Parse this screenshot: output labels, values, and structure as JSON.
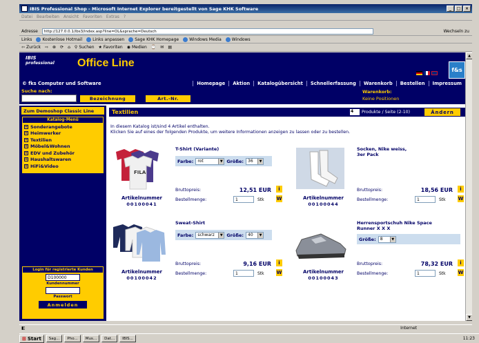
{
  "window": {
    "title": "IBIS Professional Shop - Microsoft Internet Explorer bereitgestellt von Sage KHK Software"
  },
  "menu": [
    "Datei",
    "Bearbeiten",
    "Ansicht",
    "Favoriten",
    "Extras",
    "?"
  ],
  "address": {
    "label": "Adresse",
    "url": "http://127.0.0.1/ibs3/index.asp?line=OL&sprache=Deutsch",
    "go": "Wechseln zu"
  },
  "links": {
    "label": "Links",
    "items": [
      "Kostenlose Hotmail",
      "Links anpassen",
      "Sage KHK Homepage",
      "Windows Media",
      "Windows"
    ]
  },
  "toolbar": {
    "back": "Zurück",
    "search": "Suchen",
    "favorites": "Favoriten",
    "media": "Medien"
  },
  "shop": {
    "logo_top": "IBIS",
    "logo_sub": "professional",
    "logo_main": "Office Line",
    "fs_logo": "f&s",
    "firm": "© fks Computer und Software",
    "nav": [
      "Homepage",
      "Aktion",
      "Katalogübersicht",
      "Schnellerfassung",
      "Warenkorb",
      "Bestellen",
      "Impressum"
    ],
    "search_label": "Suche nach:",
    "btn_bezeichnung": "Bezeichnung",
    "btn_artnr": "Art.-Nr.",
    "cart_label": "Warenkorb:",
    "cart_value": "Keine Positionen"
  },
  "sidebar": {
    "demoshop": "Zum Demoshop Classic Line",
    "catalog_head": "Katalog-Menü",
    "categories": [
      "Sonderangebote",
      "Heimwerker",
      "Textilien",
      "Möbel&Wohnen",
      "EDV und Zubehör",
      "Haushaltswaren",
      "HiFi&Video"
    ],
    "login_head": "Login für registrierte Kunden",
    "customer_no": "D100000",
    "customer_label": "Kundennummer",
    "password_label": "Passwort",
    "login_btn": "Anmelden"
  },
  "main": {
    "title": "Textilien",
    "per_page_value": "4",
    "per_page_label": "Produkte / Seite (2-10)",
    "change_btn": "Ändern",
    "intro1": "In diesem Katalog ist/sind 4 Artikel enthalten.",
    "intro2": "Klicken Sie auf eines der folgenden Produkte, um weitere Informationen anzeigen zu lassen oder zu bestellen."
  },
  "product_labels": {
    "artnr": "Artikelnummer",
    "price": "Bruttopreis:",
    "qty": "Bestellmenge:",
    "unit": "Stk",
    "color": "Farbe:",
    "size": "Größe:",
    "info": "i",
    "cart": "W"
  },
  "products": [
    {
      "name": "T-Shirt (Variante)",
      "number": "00100041",
      "price": "12,51 EUR",
      "qty": "1",
      "color": "rot",
      "size": "36"
    },
    {
      "name": "Socken, Nike weiss, 3er Pack",
      "number": "00100044",
      "price": "18,56 EUR",
      "qty": "1"
    },
    {
      "name": "Sweat-Shirt",
      "number": "00100042",
      "price": "9,16 EUR",
      "qty": "1",
      "color": "schwarz",
      "size": "40"
    },
    {
      "name": "Herrensportschuh Nike Space Runner X X X",
      "number": "00100043",
      "price": "78,32 EUR",
      "qty": "1",
      "size": "8"
    }
  ],
  "status": {
    "left": "",
    "zone": "Internet"
  },
  "taskbar": {
    "start": "Start",
    "items": [
      "Sag...",
      "Pho...",
      "Mus...",
      "Dat...",
      "IBIS..."
    ],
    "clock": "11:23"
  }
}
